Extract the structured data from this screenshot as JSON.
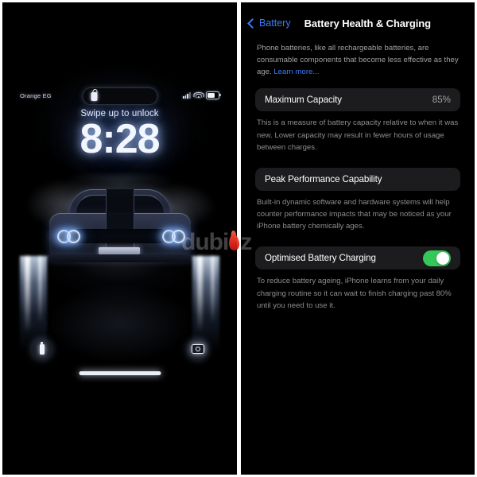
{
  "lock_screen": {
    "carrier": "Orange EG",
    "icons": {
      "signal": "signal-bars-icon",
      "wifi": "wifi-icon",
      "battery": "battery-icon",
      "dynamic_island_lock": "lock-icon"
    },
    "swipe_hint": "Swipe up to unlock",
    "time": "8:28",
    "wallpaper_description": "dodge-challenger-headlights",
    "actions": {
      "flashlight": "flashlight-icon",
      "camera": "camera-icon"
    },
    "home_indicator": "home-indicator"
  },
  "watermark": {
    "text_before": "dubi",
    "text_after": "z",
    "flame": "flame-icon",
    "full": "dubizzle"
  },
  "settings": {
    "nav": {
      "back_label": "Battery",
      "back_icon": "chevron-left-icon",
      "title": "Battery Health & Charging"
    },
    "intro": {
      "text": "Phone batteries, like all rechargeable batteries, are consumable components that become less effective as they age. ",
      "link": "Learn more..."
    },
    "rows": [
      {
        "label": "Maximum Capacity",
        "value": "85%",
        "footnote": "This is a measure of battery capacity relative to when it was new. Lower capacity may result in fewer hours of usage between charges."
      },
      {
        "label": "Peak Performance Capability",
        "value": "",
        "footnote": "Built-in dynamic software and hardware systems will help counter performance impacts that may be noticed as your iPhone battery chemically ages."
      },
      {
        "label": "Optimised Battery Charging",
        "toggle": true,
        "toggle_state": "on",
        "footnote": "To reduce battery ageing, iPhone learns from your daily charging routine so it can wait to finish charging past 80% until you need to use it."
      }
    ],
    "colors": {
      "accent_link": "#3d7dfa",
      "toggle_on": "#34c759",
      "card_background": "#1c1c1e",
      "background": "#000000",
      "secondary_text": "#a1a1a6"
    }
  }
}
